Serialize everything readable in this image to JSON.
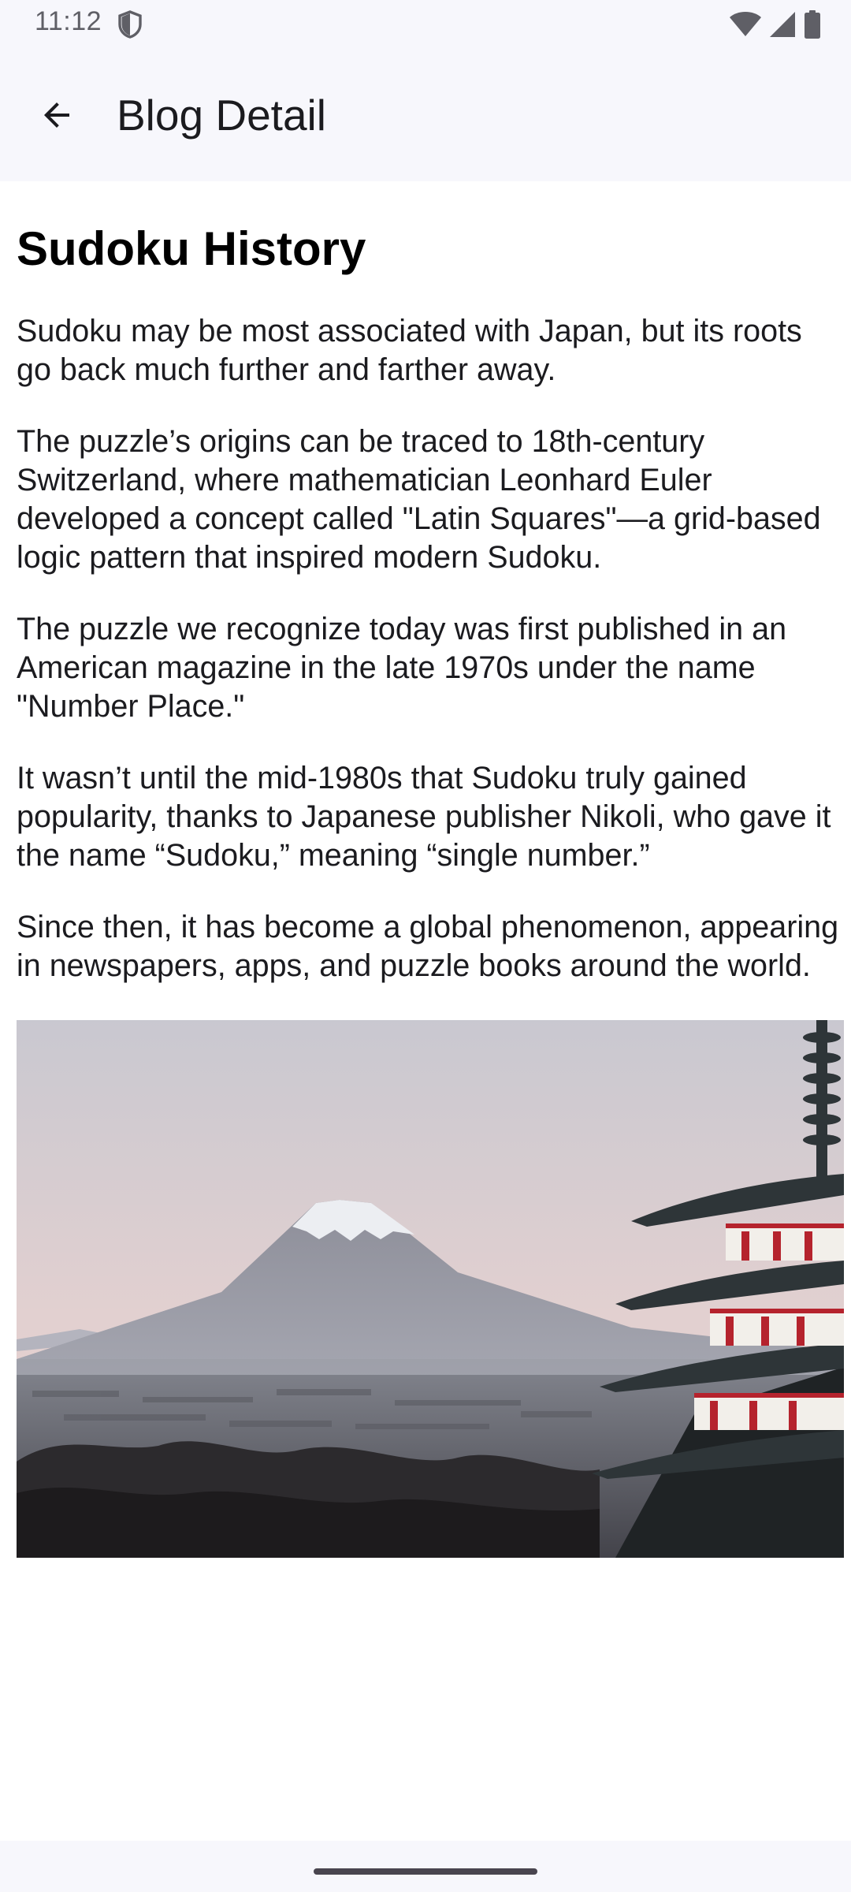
{
  "status_bar": {
    "time": "11:12",
    "icons": [
      "shield-icon",
      "wifi-icon",
      "cellular-signal-icon",
      "battery-icon"
    ]
  },
  "app_bar": {
    "back_icon": "arrow-back-icon",
    "title": "Blog Detail"
  },
  "article": {
    "title": "Sudoku History",
    "paragraphs": [
      "Sudoku may be most associated with Japan, but its roots go back much further and farther away.",
      "The puzzle’s origins can be traced to 18th-century Switzerland, where mathematician Leonhard Euler developed a concept called \"Latin Squares\"—a grid-based logic pattern that inspired modern Sudoku.",
      "The puzzle we recognize today was first published in an American magazine in the late 1970s under the name \"Number Place.\"",
      "It wasn’t until the mid-1980s that Sudoku truly gained popularity, thanks to Japanese publisher Nikoli, who gave it the name “Sudoku,” meaning “single number.”",
      "Since then, it has become a global phenomenon, appearing in newspapers, apps, and puzzle books around the world."
    ]
  },
  "colors": {
    "bar_background": "#f7f7fc",
    "text": "#1b1b1f",
    "secondary_text": "#5f5f66"
  }
}
